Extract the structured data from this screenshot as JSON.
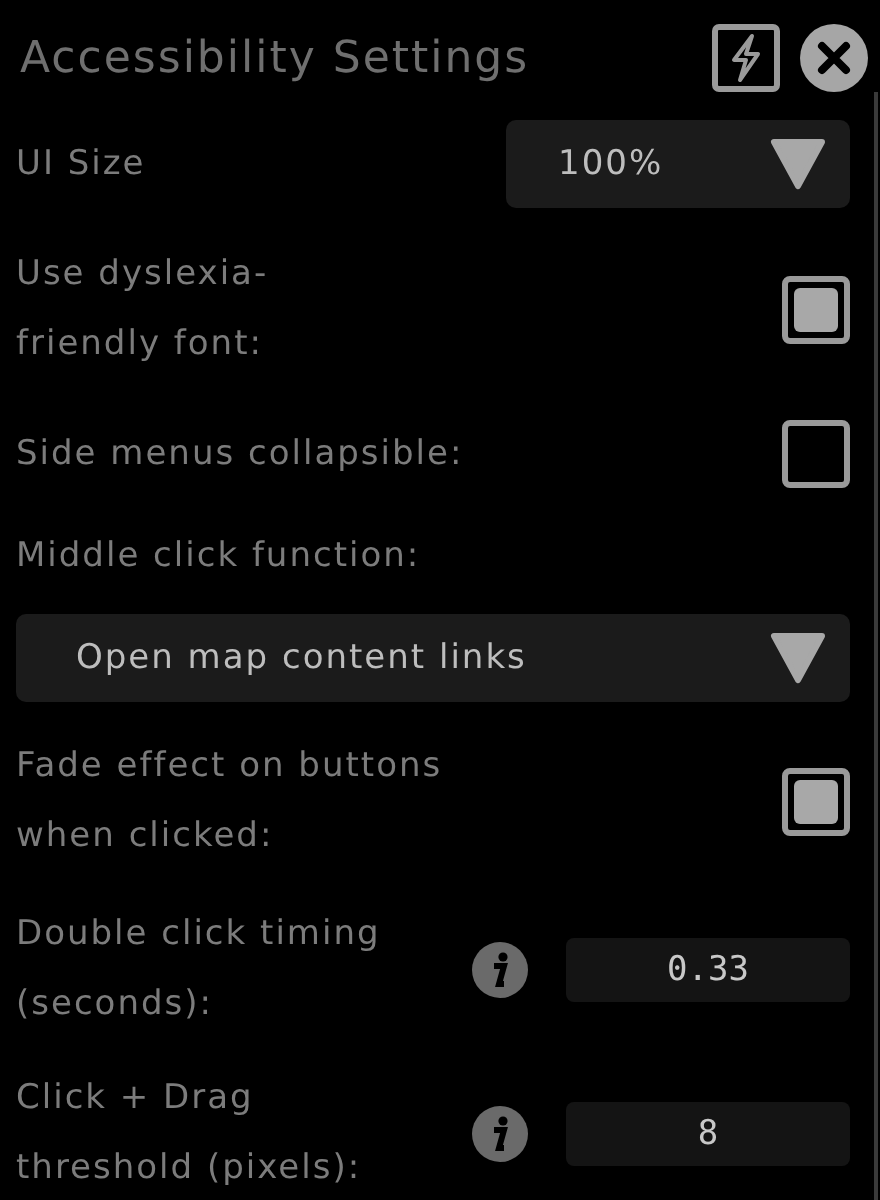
{
  "window": {
    "title": "Accessibility Settings"
  },
  "settings": [
    {
      "kind": "select",
      "label": "UI Size",
      "value": "100%"
    },
    {
      "kind": "checkbox",
      "label": "Use dyslexia-\nfriendly font:",
      "checked": true
    },
    {
      "kind": "checkbox",
      "label": "Side menus collapsible:",
      "checked": false
    },
    {
      "kind": "heading",
      "label": "Middle click function:"
    },
    {
      "kind": "wide_select",
      "value": "Open map content links"
    },
    {
      "kind": "checkbox",
      "label": "Fade effect on buttons\nwhen clicked:",
      "checked": true
    },
    {
      "kind": "number",
      "label": "Double click timing\n(seconds):",
      "value": "0.33"
    },
    {
      "kind": "number",
      "label": "Click + Drag\nthreshold (pixels):",
      "value": "8"
    }
  ]
}
